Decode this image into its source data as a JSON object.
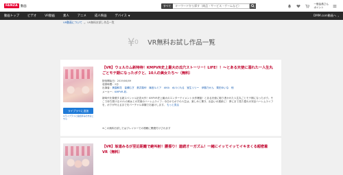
{
  "header": {
    "logo": "FANZA",
    "logo_sub": "動画",
    "search_category": "すべて",
    "search_placeholder": "キーワードから探す（商品・サービス・ゲームなど）",
    "user_line1": "一般会員さん",
    "user_line2": "ポイント"
  },
  "nav": {
    "items": [
      "動画トップ",
      "ビデオ",
      "VR動画",
      "素人",
      "アニメ",
      "成人映画",
      "デバイス"
    ],
    "right": "DMM.com動画へ"
  },
  "breadcrumb": {
    "parent": "VR動画について",
    "current": "VR無料お試し作品一覧"
  },
  "page": {
    "yen_symbol": "¥",
    "yen_zero": "0",
    "title": "VR無料お試し作品一覧"
  },
  "card1": {
    "title": "【VR】ウェルカム新特待！KMPVR史上最大の瓜穴ストーリー！LIFE！！～とある天使に溺れた一人生丸ごとモテ期になったボクと、10人の美女たち～（無料）",
    "meta": {
      "date_label": "配信開始日：",
      "date": "2019/06/09",
      "duration_label": "収録時間：",
      "duration": "2分",
      "actress_label": "出演者：",
      "actresses": "美園和花　皆瀬むぎ　蒼井梨紗　篠宮ルミア　AIKA　水川くれる　宝生リリー　伊藤乃かん　栗田ゆいな　他",
      "maker_label": "メーカー：",
      "maker": "KMPVR-彩-"
    },
    "description": "新時代を象徴する超スペシャル記念大作！KMPVR史上最大のエンターテイメント大作爆誕！とある天使に取り憑かれた人生丸ごとモテ期になったボク。そこで待ち受ける10人の美女との究極のハーレムライフ…今日からボクの人生は、楽しみと驚き、出会いの連続に！ 夢にまで見た憧れの完全ハーレムライフを、ボクが叶えるまでをバーチャル体験でお届けします。",
    "more": "もっと見る",
    "play_label": "ライブラリに追加",
    "play_help": "※ライブラリに追加済みの方はこちら",
    "note": "※この無料お試しではプレイヤーでの視聴に関連付けされます"
  },
  "card2": {
    "title": "【VR】坂道みるが至近距離で絶叫射！腰振り！連続オーガズム！一緒にイッてイッてイキまくる超密着VR（無料）"
  }
}
